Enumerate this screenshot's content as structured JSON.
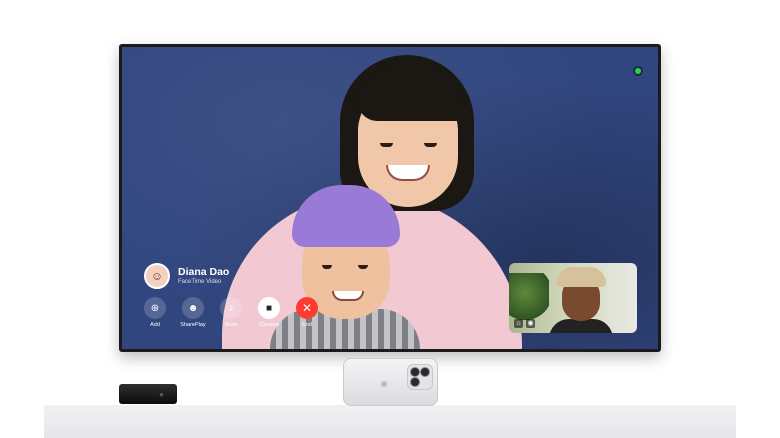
{
  "caller": {
    "name": "Diana Dao",
    "subtitle": "FaceTime Video"
  },
  "controls": [
    {
      "label": "Add",
      "icon": "add-person-icon"
    },
    {
      "label": "SharePlay",
      "icon": "shareplay-icon"
    },
    {
      "label": "Mute",
      "icon": "microphone-icon"
    },
    {
      "label": "Camera",
      "icon": "video-camera-icon"
    },
    {
      "label": "End",
      "icon": "close-icon"
    }
  ],
  "colors": {
    "screen_background": "#31467f",
    "end_call": "#ff3b30",
    "camera_indicator": "#2bd24f"
  }
}
